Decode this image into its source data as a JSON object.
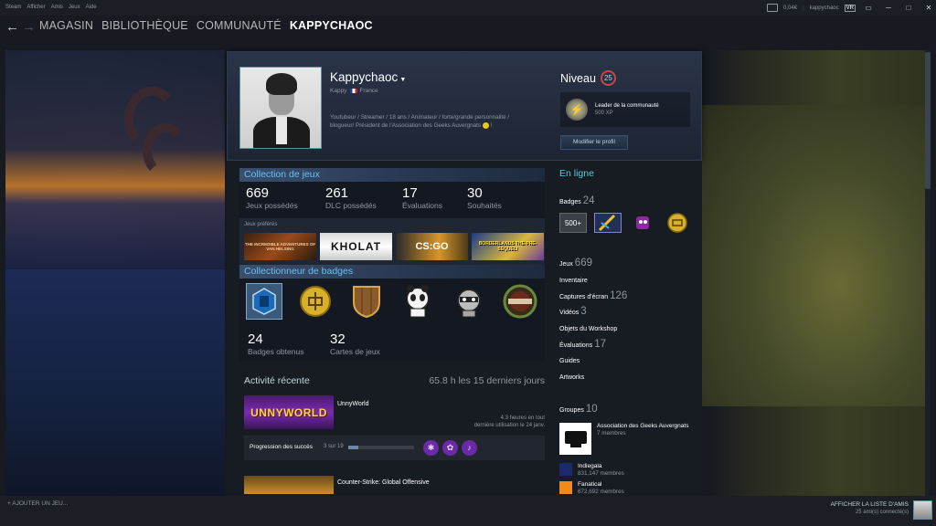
{
  "titlebar": {
    "menu": [
      "Steam",
      "Afficher",
      "Amis",
      "Jeux",
      "Aide"
    ],
    "wallet": "0,04€",
    "sep": "|",
    "username": "kappychaoc",
    "vr": "VR"
  },
  "nav": {
    "back": "←",
    "forward": "→",
    "items": [
      "MAGASIN",
      "BIBLIOTHÈQUE",
      "COMMUNAUTÉ",
      "KAPPYCHAOC"
    ]
  },
  "profile": {
    "persona": "Kappychaoc",
    "realname": "Kappy",
    "country": "France",
    "summary": "Youtubeur / Streamer / 18 ans / Animateur / forte/grande personnalité / blogueur/ Président de l'Association des Geeks Auvergnats",
    "summary_end": "!",
    "level_label": "Niveau",
    "level": "25",
    "fav_badge_name": "Leader de la communauté",
    "fav_badge_xp": "500 XP",
    "edit_button": "Modifier le profil"
  },
  "games_showcase": {
    "title": "Collection de jeux",
    "stats": [
      {
        "value": "669",
        "label": "Jeux possédés"
      },
      {
        "value": "261",
        "label": "DLC possédés"
      },
      {
        "value": "17",
        "label": "Évaluations"
      },
      {
        "value": "30",
        "label": "Souhaités"
      }
    ],
    "fav_label": "Jeux préférés",
    "fav_games": [
      "THE INCREDIBLE ADVENTURES OF VAN HELSING",
      "KHOLAT",
      "CS:GO",
      "BORDERLANDS THE PRE-SEQUEL!"
    ]
  },
  "badge_showcase": {
    "title": "Collectionneur de badges",
    "stats": [
      {
        "value": "24",
        "label": "Badges obtenus"
      },
      {
        "value": "32",
        "label": "Cartes de jeux"
      }
    ]
  },
  "activity": {
    "title": "Activité récente",
    "hours": "65.8 h les 15 derniers jours",
    "game1": {
      "capsule": "UNNYWORLD",
      "name": "UnnyWorld",
      "hours": "4.3 heures en tout",
      "last_played": "dernière utilisation le 24 janv."
    },
    "achievements": {
      "label": "Progression des succès",
      "count": "3 sur 19",
      "progress": 0.158
    },
    "game2": {
      "name": "Counter-Strike: Global Offensive"
    }
  },
  "sidebar": {
    "online": "En ligne",
    "badges_label": "Badges",
    "badges_count": "24",
    "badge_500": "500+",
    "games_label": "Jeux",
    "games_count": "669",
    "inventory": "Inventaire",
    "screenshots_label": "Captures d'écran",
    "screenshots_count": "126",
    "videos_label": "Vidéos",
    "videos_count": "3",
    "workshop": "Objets du Workshop",
    "reviews_label": "Évaluations",
    "reviews_count": "17",
    "guides": "Guides",
    "artworks": "Artworks",
    "groups_label": "Groupes",
    "groups_count": "10",
    "groups": [
      {
        "name": "Association des Geeks Auvergnats",
        "members": "7 membres"
      },
      {
        "name": "Indiegala",
        "members": "831,147 membres"
      },
      {
        "name": "Fanatical",
        "members": "672,692 membres"
      }
    ]
  },
  "bottombar": {
    "add_game": "+ AJOUTER UN JEU...",
    "friends_list": "AFFICHER LA LISTE D'AMIS",
    "friends_online": "25 ami(s) connecté(s)"
  }
}
